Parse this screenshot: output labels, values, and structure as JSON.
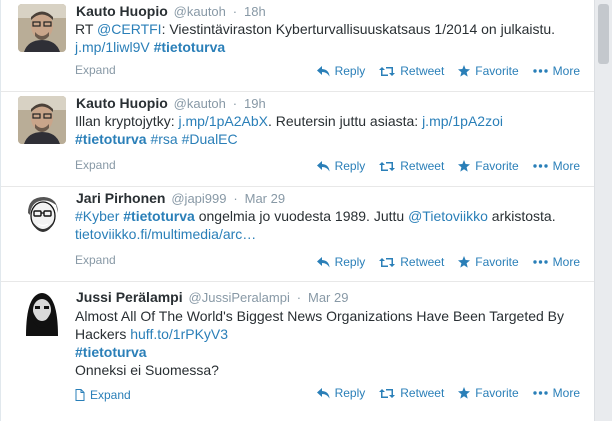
{
  "tweets": [
    {
      "fullname": "Kauto Huopio",
      "username": "@kautoh",
      "time": "18h",
      "text": [
        {
          "t": "RT "
        },
        {
          "t": "@CERTFI",
          "k": "link"
        },
        {
          "t": ": Viestintäviraston Kyberturvallisuuskatsaus 1/2014 on julkaistu."
        },
        {
          "t": "\n"
        },
        {
          "t": "j.mp/1liwl9V",
          "k": "link"
        },
        {
          "t": " "
        },
        {
          "t": "#tietoturva",
          "k": "tag"
        }
      ],
      "expand": "Expand"
    },
    {
      "fullname": "Kauto Huopio",
      "username": "@kautoh",
      "time": "19h",
      "text": [
        {
          "t": "Illan kryptojytky: "
        },
        {
          "t": "j.mp/1pA2AbX",
          "k": "link"
        },
        {
          "t": ". Reutersin juttu asiasta: "
        },
        {
          "t": "j.mp/1pA2zoi",
          "k": "link"
        },
        {
          "t": "\n"
        },
        {
          "t": "#tietoturva",
          "k": "tag"
        },
        {
          "t": " "
        },
        {
          "t": "#rsa",
          "k": "link"
        },
        {
          "t": " "
        },
        {
          "t": "#DualEC",
          "k": "link"
        }
      ],
      "expand": "Expand"
    },
    {
      "fullname": "Jari Pirhonen",
      "username": "@japi999",
      "time": "Mar 29",
      "text": [
        {
          "t": "#Kyber",
          "k": "link"
        },
        {
          "t": " "
        },
        {
          "t": "#tietoturva",
          "k": "tag"
        },
        {
          "t": " ongelmia jo vuodesta 1989. Juttu "
        },
        {
          "t": "@Tietoviikko",
          "k": "link"
        },
        {
          "t": " arkistosta."
        },
        {
          "t": "\n"
        },
        {
          "t": "tietoviikko.fi/multimedia/arc…",
          "k": "link"
        }
      ],
      "expand": "Expand"
    },
    {
      "fullname": "Jussi Perälampi",
      "username": "@JussiPeralampi",
      "time": "Mar 29",
      "text": [
        {
          "t": "Almost All Of The World's Biggest News Organizations Have Been Targeted By"
        },
        {
          "t": "\n"
        },
        {
          "t": "Hackers "
        },
        {
          "t": "huff.to/1rPKyV3",
          "k": "link"
        },
        {
          "t": "\n"
        },
        {
          "t": "#tietoturva",
          "k": "tag"
        },
        {
          "t": "\n"
        },
        {
          "t": "Onneksi ei Suomessa?"
        }
      ],
      "expand": "Expand"
    }
  ],
  "actions": {
    "reply": "Reply",
    "retweet": "Retweet",
    "favorite": "Favorite",
    "more": "More"
  },
  "colors": {
    "link": "#2a7fb8",
    "muted": "#8899a6",
    "text": "#292f33"
  }
}
